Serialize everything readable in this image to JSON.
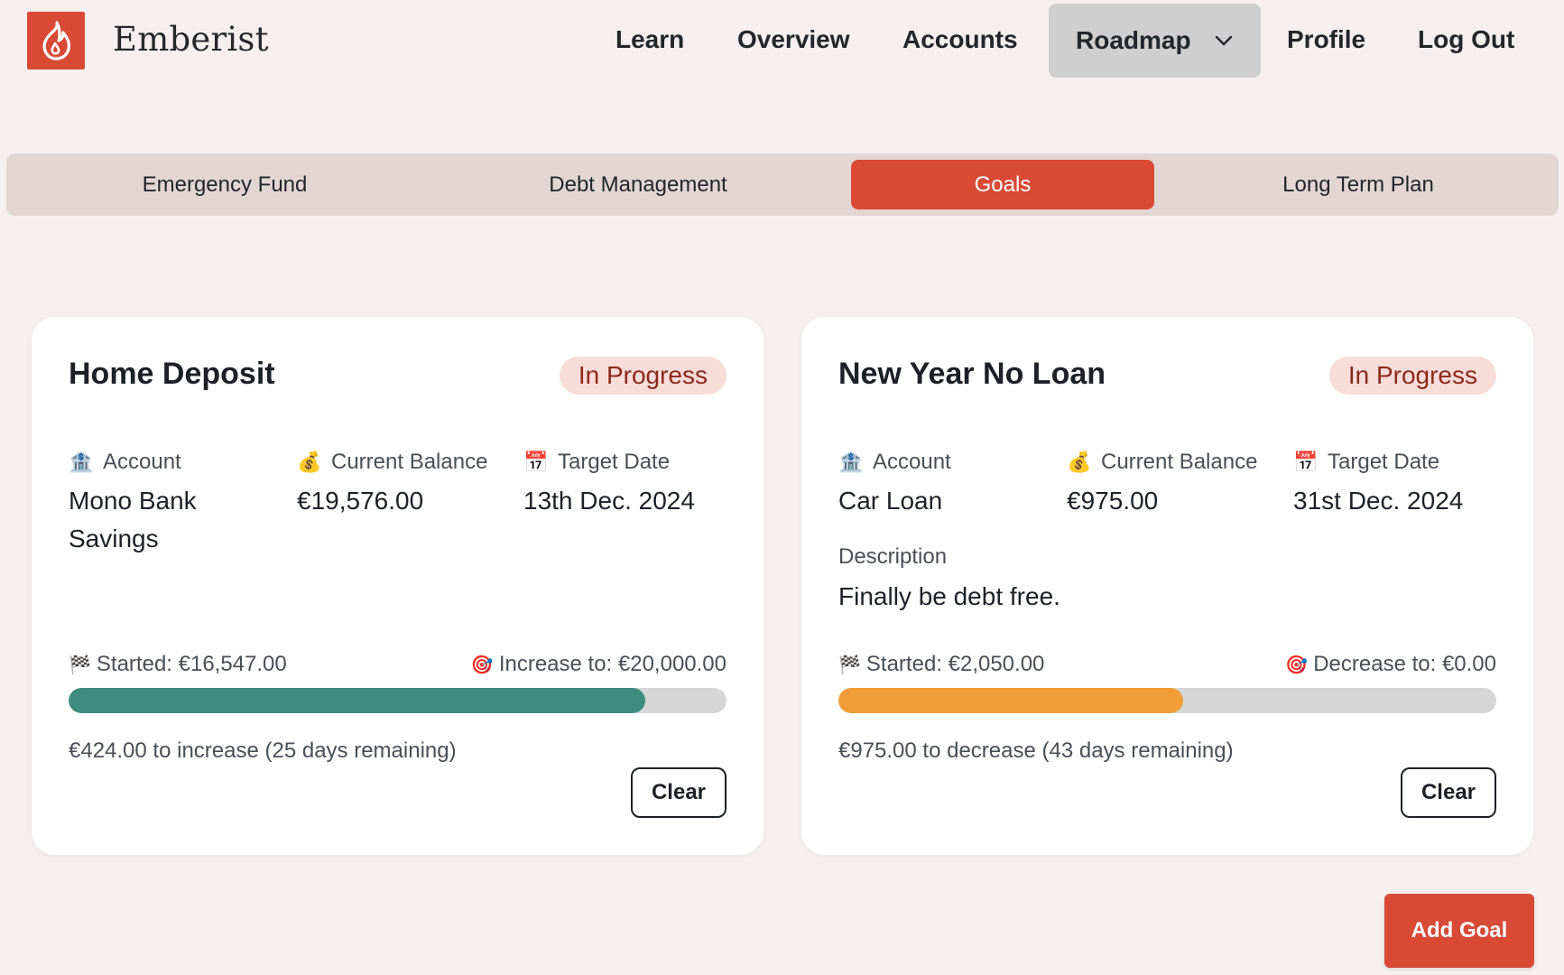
{
  "app": {
    "brand": "Emberist",
    "logo_icon": "flame-icon",
    "accent": "#d84a36"
  },
  "nav": {
    "learn": "Learn",
    "overview": "Overview",
    "accounts": "Accounts",
    "roadmap": "Roadmap",
    "profile": "Profile",
    "logout": "Log Out"
  },
  "tabs": [
    {
      "label": "Emergency Fund",
      "active": false
    },
    {
      "label": "Debt Management",
      "active": false
    },
    {
      "label": "Goals",
      "active": true
    },
    {
      "label": "Long Term Plan",
      "active": false
    }
  ],
  "goals": [
    {
      "title": "Home Deposit",
      "status": "In Progress",
      "account_label": "Account",
      "account_value": "Mono Bank Savings",
      "balance_label": "Current Balance",
      "balance_value": "€19,576.00",
      "date_label": "Target Date",
      "date_value": "13th Dec. 2024",
      "started": "Started: €16,547.00",
      "target": "Increase to: €20,000.00",
      "progress": 0.877,
      "bar_color": "#3d8c7f",
      "remaining": "€424.00 to increase (25 days remaining)",
      "clear_label": "Clear"
    },
    {
      "title": "New Year No Loan",
      "status": "In Progress",
      "account_label": "Account",
      "account_value": "Car Loan",
      "balance_label": "Current Balance",
      "balance_value": "€975.00",
      "date_label": "Target Date",
      "date_value": "31st Dec. 2024",
      "description_label": "Description",
      "description_value": "Finally be debt free.",
      "started": "Started: €2,050.00",
      "target": "Decrease to: €0.00",
      "progress": 0.524,
      "bar_color": "#f29c38",
      "remaining": "€975.00 to decrease (43 days remaining)",
      "clear_label": "Clear"
    }
  ],
  "add_goal_label": "Add Goal"
}
